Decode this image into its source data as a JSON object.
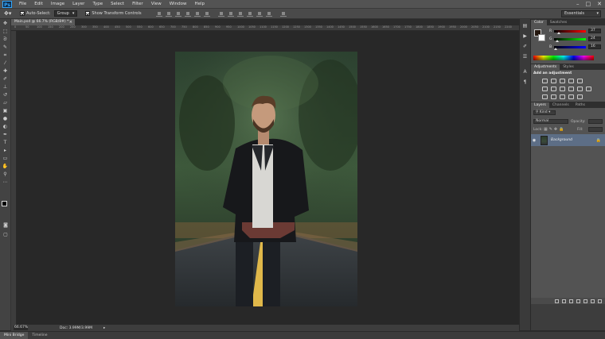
{
  "app": {
    "logo": "Ps"
  },
  "menu": [
    "File",
    "Edit",
    "Image",
    "Layer",
    "Type",
    "Select",
    "Filter",
    "View",
    "Window",
    "Help"
  ],
  "window_controls": [
    "–",
    "□",
    "✕"
  ],
  "options_bar": {
    "auto_select_label": "Auto-Select:",
    "auto_select_value": "Group",
    "transform_label": "Show Transform Controls",
    "workspace": "Essentials"
  },
  "document": {
    "tab_title": "Main.psd @ 66.7% (RGB/8#) *",
    "tab_close": "×",
    "zoom": "66.67%",
    "doc_info": "Doc: 3.99M/3.99M"
  },
  "ruler_ticks": [
    "0",
    "50",
    "100",
    "150",
    "200",
    "250",
    "300",
    "350",
    "400",
    "450",
    "500",
    "550",
    "600",
    "650",
    "700",
    "750",
    "800",
    "850",
    "900",
    "950",
    "1000",
    "1050",
    "1100",
    "1150",
    "1200",
    "1250",
    "1300",
    "1350",
    "1400",
    "1450",
    "1500",
    "1550",
    "1600",
    "1650",
    "1700",
    "1750",
    "1800",
    "1850",
    "1900",
    "1950",
    "2000",
    "2050",
    "2100",
    "2150",
    "2200"
  ],
  "bottom_tabs": [
    "Mini Bridge",
    "Timeline"
  ],
  "color_panel": {
    "tabs": [
      "Color",
      "Swatches"
    ],
    "channels": [
      {
        "label": "R",
        "value": "37",
        "level": 0.15
      },
      {
        "label": "G",
        "value": "24",
        "level": 0.09
      },
      {
        "label": "B",
        "value": "16",
        "level": 0.06
      }
    ]
  },
  "adjustments_panel": {
    "tabs": [
      "Adjustments",
      "Styles"
    ],
    "title": "Add an adjustment"
  },
  "layers_panel": {
    "tabs": [
      "Layers",
      "Channels",
      "Paths"
    ],
    "filter_kind": "Kind",
    "blend_mode": "Normal",
    "opacity_label": "Opacity:",
    "lock_label": "Lock:",
    "fill_label": "Fill:",
    "layer_name": "Background"
  },
  "colors": {
    "photoshop_blue": "#31a8ff",
    "layer_selected": "#5d6e86",
    "road_line": "#e0b84a"
  }
}
